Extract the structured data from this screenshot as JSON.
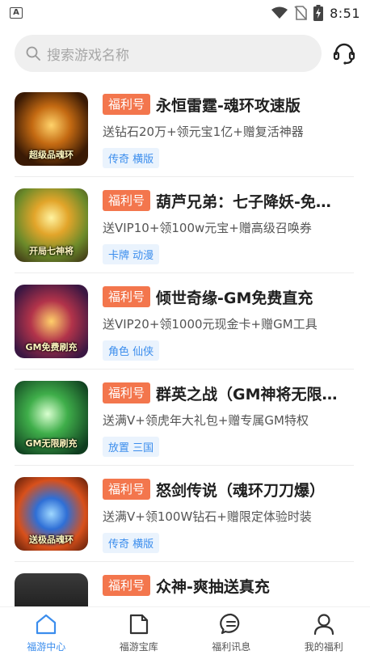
{
  "status_bar": {
    "time": "8:51",
    "left_badge": "A"
  },
  "search": {
    "placeholder": "搜索游戏名称"
  },
  "colors": {
    "accent": "#3b8ded",
    "badge": "#f3764d",
    "tag_bg": "#eaf3fd"
  },
  "games": [
    {
      "badge": "福利号",
      "title": "永恒雷霆-魂环攻速版",
      "desc": "送钻石20万+领元宝1亿+赠复活神器",
      "tags": "传奇 横版",
      "thumb_text": "超级品魂环"
    },
    {
      "badge": "福利号",
      "title": "葫芦兄弟：七子降妖-免…",
      "desc": "送VIP10+领100w元宝+赠高级召唤券",
      "tags": "卡牌 动漫",
      "thumb_text": "开局七神将"
    },
    {
      "badge": "福利号",
      "title": "倾世奇缘-GM免费直充",
      "desc": "送VIP20+领1000元现金卡+赠GM工具",
      "tags": "角色 仙侠",
      "thumb_text": "GM免费刷充"
    },
    {
      "badge": "福利号",
      "title": "群英之战（GM神将无限…",
      "desc": "送满V+领虎年大礼包+赠专属GM特权",
      "tags": "放置 三国",
      "thumb_text": "GM无限刷充"
    },
    {
      "badge": "福利号",
      "title": "怒剑传说（魂环刀刀爆）",
      "desc": "送满V+领100W钻石+赠限定体验时装",
      "tags": "传奇 横版",
      "thumb_text": "送极品魂环"
    },
    {
      "badge": "福利号",
      "title": "众神-爽抽送真充",
      "desc": "",
      "tags": "",
      "thumb_text": ""
    }
  ],
  "tabs": [
    {
      "label": "福游中心",
      "icon": "home-icon",
      "active": true
    },
    {
      "label": "福游宝库",
      "icon": "folder-icon",
      "active": false
    },
    {
      "label": "福利讯息",
      "icon": "chat-icon",
      "active": false
    },
    {
      "label": "我的福利",
      "icon": "user-icon",
      "active": false
    }
  ]
}
